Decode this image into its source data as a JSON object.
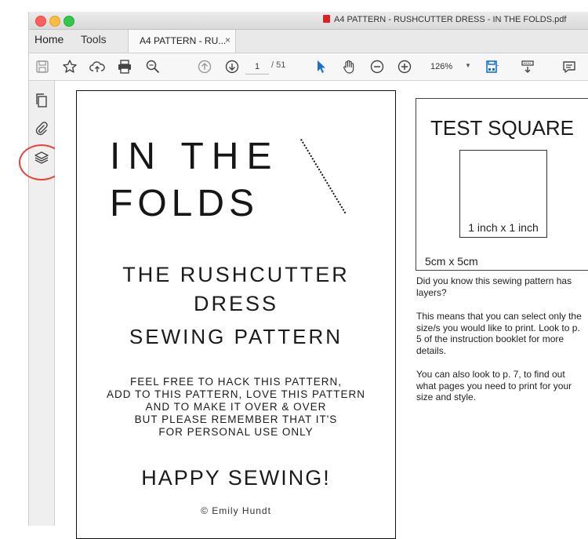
{
  "window": {
    "title": "A4 PATTERN - RUSHCUTTER DRESS - IN THE FOLDS.pdf"
  },
  "nav": {
    "home": "Home",
    "tools": "Tools"
  },
  "tab": {
    "label": "A4 PATTERN - RU...",
    "close": "×"
  },
  "toolbar": {
    "page_current": "1",
    "page_total": "/ 51",
    "zoom": "126%",
    "icons": [
      "save-icon",
      "bookmark-star-icon",
      "upload-cloud-icon",
      "print-icon",
      "zoom-search-icon",
      "page-up-icon",
      "page-down-icon",
      "select-arrow-icon",
      "hand-icon",
      "zoom-out-icon",
      "zoom-in-icon",
      "fit-page-icon",
      "scroll-mode-icon",
      "comment-icon"
    ]
  },
  "sidebar": {
    "icons": [
      "pages-icon",
      "attachment-icon",
      "layers-icon"
    ]
  },
  "document": {
    "logo_line1": "IN THE",
    "logo_line2": "FOLDS",
    "title_line1": "THE RUSHCUTTER",
    "title_line2": "DRESS",
    "title_line3": "SEWING PATTERN",
    "para": [
      "FEEL FREE TO HACK THIS PATTERN,",
      "ADD TO THIS PATTERN, LOVE THIS PATTERN",
      "AND TO MAKE IT OVER & OVER",
      "BUT PLEASE REMEMBER THAT IT'S",
      "FOR PERSONAL USE ONLY"
    ],
    "happy": "HAPPY SEWING!",
    "credit": "© Emily Hundt",
    "test_square": {
      "title": "TEST SQUARE",
      "inner": "1 inch x 1 inch",
      "outer": "5cm x 5cm"
    },
    "notes": [
      "Did you know this sewing pattern has layers?",
      "This means that you can select only the size/s you would like to print. Look to p. 5 of the instruction booklet for more details.",
      "You can also look to p. 7, to find out what pages you need to print for your size and style."
    ]
  },
  "colors": {
    "annotation": "#e8433a",
    "accent_blue": "#1a6fd8"
  }
}
